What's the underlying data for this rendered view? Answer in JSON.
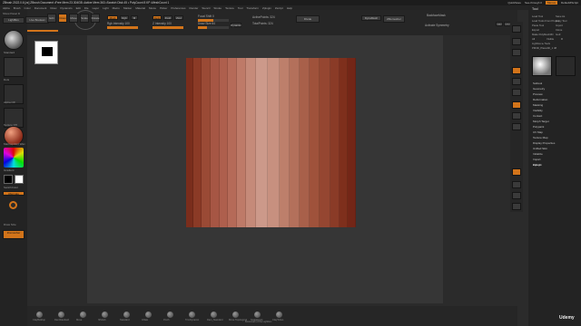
{
  "window": {
    "title": "ZBrush 2022.0.6 [zz] ZBrush Document   ▪Free Mem 23.304GB ▪Active Mem 363 ▪Scratch Disk 45 ▪ PolyCount 8 KP ▪MeshCount 1",
    "quicksave": "QuickSave",
    "see_through": "See-through 0",
    "menus_btn": "Menus",
    "default_script": "DefaultZScript"
  },
  "menubar": {
    "items": [
      "Alpha",
      "Brush",
      "Color",
      "Document",
      "Draw",
      "Dynamics",
      "Edit",
      "File",
      "Layer",
      "Light",
      "Macro",
      "Marker",
      "Material",
      "Movie",
      "Picker",
      "Preferences",
      "Render",
      "Stencil",
      "Stroke",
      "Texture",
      "Tool",
      "Transform",
      "Zplugin",
      "Zscript",
      "Help"
    ]
  },
  "left": {
    "header": "Show Panel D",
    "lightbox": "LightBox",
    "brush_label": "Standard",
    "stroke_label": "Dots",
    "alpha_label": "Alpha Off",
    "texture_label": "Texture Off",
    "material_label": "MatCap Red Wax",
    "gradient_label": "Gradient",
    "switch_color": "SwitchColor",
    "alternate": "Alternate",
    "draw_size_label": "Draw Size",
    "zremesher": "Zremesher"
  },
  "shelf": {
    "live_boolean": "Live Boolean",
    "edit": "Edit",
    "draw": "Draw",
    "move": "Move",
    "scale": "Scale",
    "rotate": "Rotate",
    "mrgb": "Mrgb",
    "rgb": "Rgb",
    "m": "M",
    "zadd": "Zadd",
    "zsub": "Zsub",
    "zcut": "Zcut",
    "focal_shift": "Focal Shift 0",
    "draw_size": "Draw Size 64",
    "dynamic": "Dynamic",
    "rgb_intensity": "Rgb Intensity 100",
    "z_intensity": "Z Intensity 100",
    "active_points": "ActivePoints: 324",
    "total_points": "TotalPoints: 324",
    "divide": "Divide",
    "smt": "Smt",
    "suv": "Suv",
    "rel": "Rel",
    "dynamesh": "DynaMesh",
    "resolution": "Resolution 128",
    "zremesher": "ZRemesher",
    "target_polygons": "Target Polygons Count 5",
    "backface_mask": "BackfaceMask",
    "activate_symmetry": "Activate Symmetry",
    "x": ">X<",
    "y": ">Y<",
    "z": ">Z<",
    "mirror": "Mirror"
  },
  "mesh_colors": [
    "#7a2d1c",
    "#8b3a26",
    "#9a4a35",
    "#a65644",
    "#ae5f4d",
    "#b56a58",
    "#be7a68",
    "#c58a79",
    "#cc998a",
    "#c7907f",
    "#bd7f6b",
    "#b3705b",
    "#a8604a",
    "#9f523b",
    "#954631",
    "#8a3b27",
    "#7e2f1c",
    "#732617"
  ],
  "mesh_bands": [
    6,
    6,
    7,
    7,
    7,
    7,
    7,
    8,
    9,
    9,
    8,
    8,
    8,
    8,
    8,
    7,
    7,
    6
  ],
  "right": {
    "title": "Tool",
    "grid": [
      [
        "Load Tool",
        "Save As"
      ],
      [
        "Load Tools From Project",
        "Copy Tool"
      ],
      [
        "Paste Tool",
        "Import"
      ],
      [
        "Export",
        "Clone"
      ],
      [
        "Make PolyMesh3D",
        "GoZ"
      ],
      [
        "All",
        "Visible",
        "R"
      ],
      [
        "Lightbox ▸ Tools"
      ],
      [
        "PM3D_Plane3D_1  48"
      ]
    ],
    "menu": [
      "Subtool",
      "Geometry",
      "Preview",
      "Deformation",
      "Masking",
      "Visibility",
      "Contact",
      "Morph Target",
      "Polypaint",
      "UV Map",
      "Texture Map",
      "Display Properties",
      "Unified Skin",
      "Initialize",
      "Import",
      "Export"
    ],
    "zplugin": "Zplugin"
  },
  "bottom": {
    "brushes": [
      "ClayBuildup",
      "DamStandard",
      "Move",
      "hPolish",
      "Standard",
      "Inflate",
      "Pinch",
      "TrimDynamic",
      "Dam_Standard",
      "Move Topological",
      "SnakeHook",
      "ClayTubes"
    ],
    "center_label": "Bookmark of the Lightbox"
  },
  "watermark": "Udemy"
}
